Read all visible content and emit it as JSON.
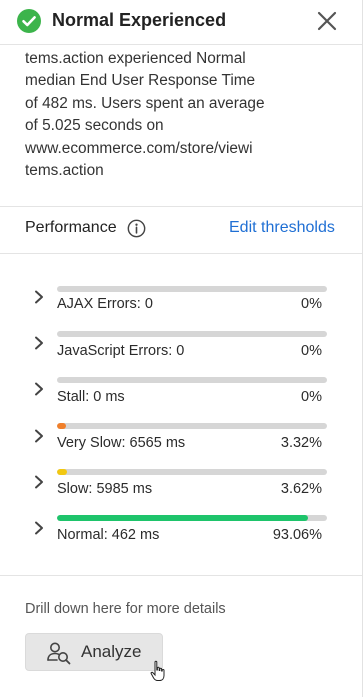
{
  "header": {
    "title": "Normal Experienced",
    "status_icon": "check-circle-icon",
    "status_color": "#3cb44b",
    "close_icon": "close-icon"
  },
  "description": {
    "lines": [
      "tems.action experienced Normal",
      "median End User Response Time",
      "of 482 ms. Users spent an average",
      "of 5.025 seconds on",
      "www.ecommerce.com/store/viewi",
      "tems.action"
    ]
  },
  "performance": {
    "title": "Performance",
    "info_icon": "info-icon",
    "edit_link": "Edit thresholds",
    "metrics": [
      {
        "label": "AJAX Errors: 0",
        "percent": "0%",
        "fraction": 0,
        "color": "#d6d6d6"
      },
      {
        "label": "JavaScript Errors: 0",
        "percent": "0%",
        "fraction": 0,
        "color": "#d6d6d6"
      },
      {
        "label": "Stall: 0 ms",
        "percent": "0%",
        "fraction": 0,
        "color": "#d6d6d6"
      },
      {
        "label": "Very Slow: 6565 ms",
        "percent": "3.32%",
        "fraction": 0.0332,
        "color": "#f07f2a"
      },
      {
        "label": "Slow: 5985 ms",
        "percent": "3.62%",
        "fraction": 0.0362,
        "color": "#f2c811"
      },
      {
        "label": "Normal: 462 ms",
        "percent": "93.06%",
        "fraction": 0.9306,
        "color": "#1ec46b"
      }
    ]
  },
  "footer": {
    "drill_text": "Drill down here for more details",
    "analyze_label": "Analyze",
    "analyze_icon": "user-search-icon"
  },
  "colors": {
    "accent_link": "#1f6fd4",
    "success": "#3cb44b"
  }
}
